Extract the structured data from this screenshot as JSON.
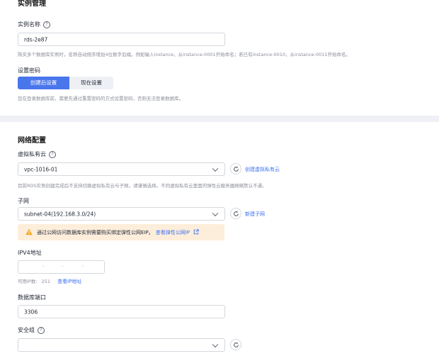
{
  "instance": {
    "section_title": "实例管理",
    "name_label": "实例名称",
    "name_value": "rds-2e87",
    "name_hint": "购买多个数据库实例时，名称自动按序增加4位数字后缀。例如输入instance，从instance-0001开始命名；若已有instance-0010，从instance-0011开始命名。",
    "password_label": "设置密码",
    "password_options": [
      "创建后设置",
      "现在设置"
    ],
    "password_selected": "创建后设置",
    "password_hint": "您在登录数据库前，需要先通过重置密码的方式设置密码，否则无法登录数据库。"
  },
  "network": {
    "section_title": "网络配置",
    "vpc_label": "虚拟私有云",
    "vpc_value": "vpc-1016-01",
    "vpc_create_link": "创建虚拟私有云",
    "vpc_hint": "目前RDS实例创建完成后不支持切换虚拟私有云与子网，请谨慎选择。不同虚拟私有云里面的弹性云服务器网络默认不通。",
    "subnet_label": "子网",
    "subnet_value": "subnet-04(192.168.3.0/24)",
    "subnet_create_link": "新建子网",
    "eip_warning": "通过公网访问数据库实例需要购买绑定弹性公网EIP。",
    "eip_link": "查看弹性公网IP",
    "ipv4_label": "IPV4地址",
    "ipv4_available_label": "可用IP数:",
    "ipv4_available_count": "251",
    "ipv4_view_link": "查看IP地址",
    "port_label": "数据库端口",
    "port_value": "3306",
    "security_group_label": "安全组"
  },
  "icons": {
    "help": "help-circle-icon",
    "refresh": "refresh-icon",
    "dropdown": "chevron-down-icon",
    "warning": "warning-triangle-icon",
    "external": "external-link-icon"
  },
  "colors": {
    "primary": "#4a76ec",
    "link": "#3b6ff2",
    "warning_bg": "#fdeedb",
    "warning_icon": "#f5a623"
  }
}
